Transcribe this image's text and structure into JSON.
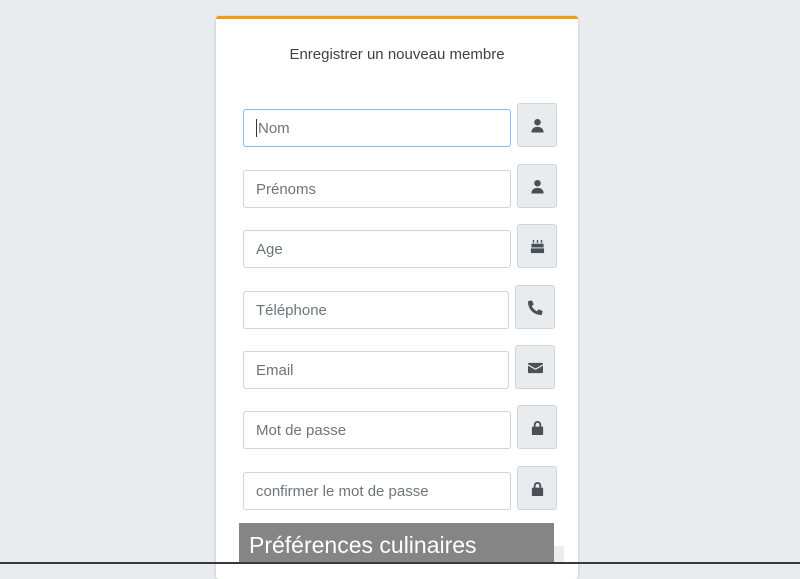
{
  "form": {
    "title": "Enregistrer un nouveau membre",
    "accent_color": "#f39c12",
    "fields": [
      {
        "name": "nom",
        "placeholder": "Nom",
        "value": "",
        "icon": "user-icon",
        "focused": true
      },
      {
        "name": "prenoms",
        "placeholder": "Prénoms",
        "value": "",
        "icon": "user-icon"
      },
      {
        "name": "age",
        "placeholder": "Age",
        "value": "",
        "icon": "birthday-cake-icon"
      },
      {
        "name": "telephone",
        "placeholder": "Téléphone",
        "value": "",
        "icon": "phone-icon"
      },
      {
        "name": "email",
        "placeholder": "Email",
        "value": "",
        "icon": "envelope-icon"
      },
      {
        "name": "mot-de-passe",
        "placeholder": "Mot de passe",
        "value": "",
        "icon": "lock-icon"
      },
      {
        "name": "confirmer-mot-de-passe",
        "placeholder": "confirmer le mot de passe",
        "value": "",
        "icon": "lock-icon"
      }
    ]
  },
  "preferences": {
    "heading": "Préférences culinaires"
  }
}
